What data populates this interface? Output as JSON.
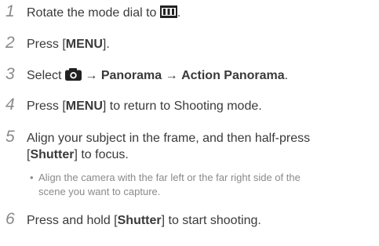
{
  "steps": [
    {
      "num": "1",
      "pre": "Rotate the mode dial to",
      "icon": "panorama-mode-icon",
      "post": "."
    },
    {
      "num": "2",
      "pre": "Press [",
      "bold": "MENU",
      "post": "]."
    },
    {
      "num": "3",
      "pre": "Select",
      "icon": "camera-icon",
      "arrow1": " → ",
      "bold1": "Panorama",
      "arrow2": " → ",
      "bold2": "Action Panorama",
      "post": "."
    },
    {
      "num": "4",
      "pre": "Press [",
      "bold": "MENU",
      "post": "] to return to Shooting mode."
    },
    {
      "num": "5",
      "line1": "Align your subject in the frame, and then half-press",
      "pre": "[",
      "bold": "Shutter",
      "post": "] to focus."
    },
    {
      "num": "6",
      "pre": "Press and hold [",
      "bold": "Shutter",
      "post": "] to start shooting."
    }
  ],
  "note": {
    "bullet": "•",
    "line1": "Align the camera with the far left or the far right side of the",
    "line2": "scene you want to capture."
  }
}
